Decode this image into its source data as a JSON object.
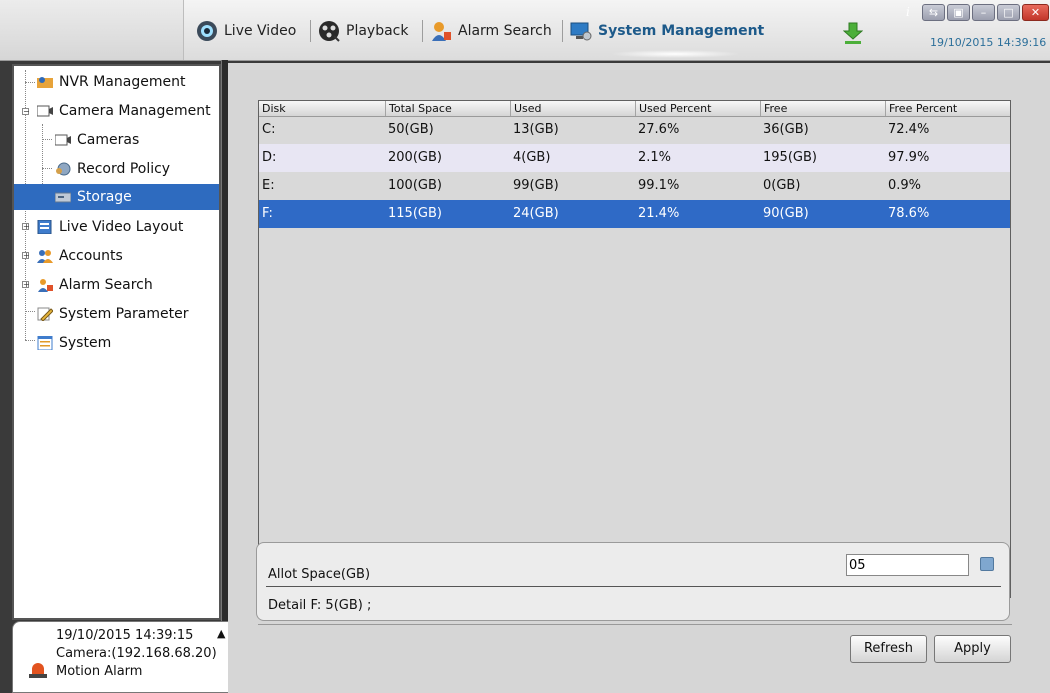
{
  "toolbar": {
    "nav": [
      {
        "label": "Live Video",
        "icon": "eye-icon"
      },
      {
        "label": "Playback",
        "icon": "film-reel-icon"
      },
      {
        "label": "Alarm Search",
        "icon": "alarm-user-icon"
      },
      {
        "label": "System Management",
        "icon": "computer-settings-icon",
        "active": true
      }
    ],
    "clock": "19/10/2015 14:39:16",
    "info_glyph": "i",
    "window_controls": [
      "restore",
      "tile",
      "minimize",
      "maximize",
      "close"
    ]
  },
  "tree": {
    "items": [
      {
        "label": "NVR Management",
        "icon": "nvr-user-icon"
      },
      {
        "label": "Camera Management",
        "icon": "camera-icon",
        "expanded": true
      },
      {
        "label": "Cameras",
        "icon": "camera-icon"
      },
      {
        "label": "Record Policy",
        "icon": "record-gear-icon"
      },
      {
        "label": "Storage",
        "icon": "storage-icon",
        "selected": true
      },
      {
        "label": "Live Video Layout",
        "icon": "layout-icon"
      },
      {
        "label": "Accounts",
        "icon": "users-icon"
      },
      {
        "label": "Alarm Search",
        "icon": "alarm-user-icon"
      },
      {
        "label": "System Parameter",
        "icon": "pencil-icon"
      },
      {
        "label": "System",
        "icon": "window-icon"
      }
    ]
  },
  "disk_table": {
    "columns": [
      "Disk",
      "Total Space",
      "Used",
      "Used Percent",
      "Free",
      "Free Percent"
    ],
    "rows": [
      [
        "C:",
        "50(GB)",
        "13(GB)",
        "27.6%",
        "36(GB)",
        "72.4%"
      ],
      [
        "D:",
        "200(GB)",
        "4(GB)",
        "2.1%",
        "195(GB)",
        "97.9%"
      ],
      [
        "E:",
        "100(GB)",
        "99(GB)",
        "99.1%",
        "0(GB)",
        "0.9%"
      ],
      [
        "F:",
        "115(GB)",
        "24(GB)",
        "21.4%",
        "90(GB)",
        "78.6%"
      ]
    ],
    "selected_row": 3
  },
  "allot": {
    "label": "Allot Space(GB)",
    "value": "05",
    "detail_label": "Detail",
    "detail_value": "F: 5(GB) ;"
  },
  "buttons": {
    "refresh": "Refresh",
    "apply": "Apply"
  },
  "alarm_popup": {
    "time": "19/10/2015 14:39:15",
    "camera": "Camera:(192.168.68.20)",
    "type": "Motion Alarm",
    "collapse_glyph": "▲",
    "close_glyph": "✕"
  },
  "colors": {
    "selection": "#2f6ac6",
    "active_nav": "#1d5a8a",
    "clock": "#2c6f9a",
    "alt_row": "#e8e6f3"
  }
}
